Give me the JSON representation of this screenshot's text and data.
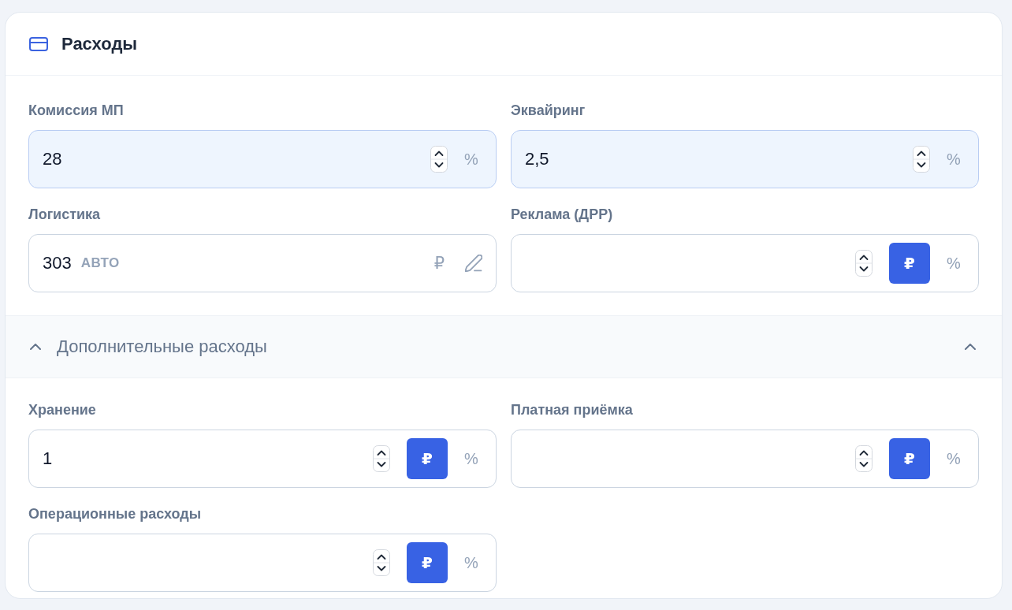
{
  "card": {
    "title": "Расходы"
  },
  "fields": [
    {
      "kind": "percent",
      "label": "Комиссия МП",
      "value": "28",
      "highlighted": true,
      "unit": "%"
    },
    {
      "kind": "percent",
      "label": "Эквайринг",
      "value": "2,5",
      "highlighted": true,
      "unit": "%"
    },
    {
      "kind": "auto",
      "label": "Логистика",
      "value": "303",
      "highlighted": false,
      "badge": "АВТО",
      "unit": "₽"
    },
    {
      "kind": "toggle",
      "label": "Реклама (ДРР)",
      "highlighted": false,
      "units": [
        {
          "label": "₽",
          "selected": true
        },
        {
          "label": "%",
          "selected": false
        }
      ]
    }
  ],
  "extra_section": {
    "title": "Дополнительные расходы",
    "expanded": true,
    "fields": [
      {
        "kind": "toggle",
        "label": "Хранение",
        "value": "1",
        "highlighted": false,
        "units": [
          {
            "label": "₽",
            "selected": true
          },
          {
            "label": "%",
            "selected": false
          }
        ]
      },
      {
        "kind": "toggle",
        "label": "Платная приёмка",
        "highlighted": false,
        "units": [
          {
            "label": "₽",
            "selected": true
          },
          {
            "label": "%",
            "selected": false
          }
        ]
      },
      {
        "kind": "toggle",
        "label": "Операционные расходы",
        "highlighted": false,
        "units": [
          {
            "label": "₽",
            "selected": true
          },
          {
            "label": "%",
            "selected": false
          }
        ]
      }
    ]
  }
}
